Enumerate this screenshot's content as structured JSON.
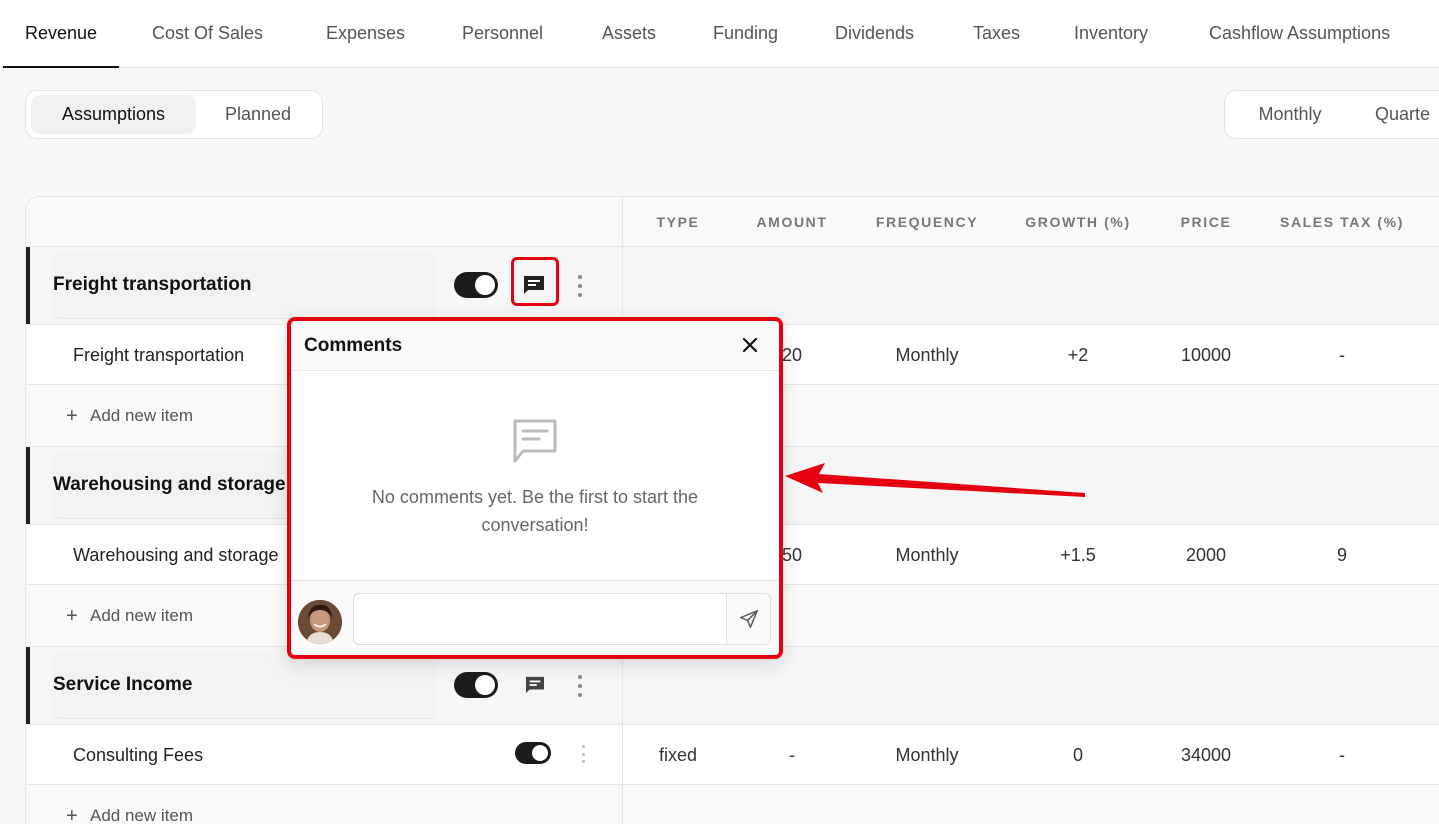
{
  "top_tabs": [
    "Revenue",
    "Cost Of Sales",
    "Expenses",
    "Personnel",
    "Assets",
    "Funding",
    "Dividends",
    "Taxes",
    "Inventory",
    "Cashflow Assumptions"
  ],
  "view_toggle": {
    "options": [
      "Assumptions",
      "Planned"
    ],
    "selected": "Assumptions"
  },
  "period_toggle": {
    "options": [
      "Monthly",
      "Quarte"
    ],
    "selected": "Monthly"
  },
  "columns": [
    "TYPE",
    "AMOUNT",
    "FREQUENCY",
    "GROWTH (%)",
    "PRICE",
    "SALES TAX (%)"
  ],
  "groups": [
    {
      "name": "Freight transportation",
      "item": {
        "name": "Freight transportation",
        "type": "",
        "amount": "20",
        "frequency": "Monthly",
        "growth": "+2",
        "price": "10000",
        "sales_tax": "-"
      },
      "add_label": "Add new item"
    },
    {
      "name": "Warehousing and storage",
      "item": {
        "name": "Warehousing and storage",
        "type": "",
        "amount": "50",
        "frequency": "Monthly",
        "growth": "+1.5",
        "price": "2000",
        "sales_tax": "9"
      },
      "add_label": "Add new item"
    },
    {
      "name": "Service Income",
      "item": {
        "name": "Consulting Fees",
        "type": "fixed",
        "amount": "-",
        "frequency": "Monthly",
        "growth": "0",
        "price": "34000",
        "sales_tax": "-"
      },
      "add_label": "Add new item"
    }
  ],
  "comments_popover": {
    "title": "Comments",
    "empty_message": "No comments yet. Be the first to start the conversation!",
    "input_value": "",
    "input_placeholder": ""
  },
  "colors": {
    "highlight": "#e4000e",
    "toggle_on": "#1b1b1b"
  },
  "icons": [
    "comment-icon",
    "close-icon",
    "send-icon",
    "more-vertical-icon",
    "plus-icon"
  ]
}
